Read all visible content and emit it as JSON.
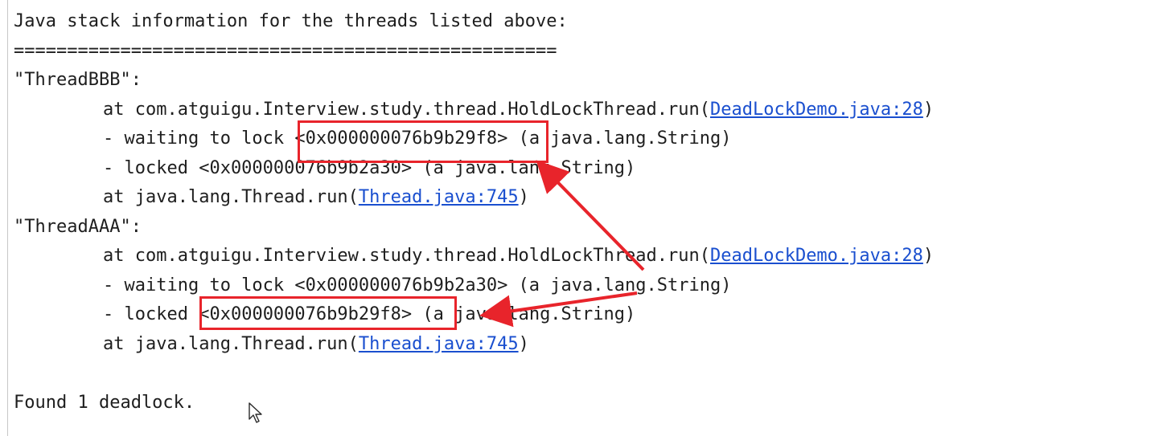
{
  "console": {
    "header": "Java stack information for the threads listed above:",
    "separator": "===================================================",
    "thread_bbb": {
      "name": "\"ThreadBBB\":",
      "at_prefix": "at com.atguigu.Interview.study.thread.HoldLockThread.run(",
      "at_link": "DeadLockDemo.java:28",
      "at_suffix": ")",
      "waiting_prefix": "- waiting to lock ",
      "waiting_address": "<0x000000076b9b29f8>",
      "waiting_suffix": " (a java.lang.String)",
      "locked": "- locked <0x000000076b9b2a30> (a java.lang.String)",
      "run_prefix": "at java.lang.Thread.run(",
      "run_link": "Thread.java:745",
      "run_suffix": ")"
    },
    "thread_aaa": {
      "name": "\"ThreadAAA\":",
      "at_prefix": "at com.atguigu.Interview.study.thread.HoldLockThread.run(",
      "at_link": "DeadLockDemo.java:28",
      "at_suffix": ")",
      "waiting": "- waiting to lock <0x000000076b9b2a30> (a java.lang.String)",
      "locked_prefix": "- locked ",
      "locked_address": "<0x000000076b9b29f8>",
      "locked_suffix": " (a java.lang.String)",
      "run_prefix": "at java.lang.Thread.run(",
      "run_link": "Thread.java:745",
      "run_suffix": ")"
    },
    "footer": "Found 1 deadlock."
  },
  "colors": {
    "text": "#1e1e1e",
    "link": "#1a4fcf",
    "annotation": "#e8242b",
    "background": "#ffffff"
  },
  "icons": {
    "cursor": "mouse-pointer-icon"
  }
}
